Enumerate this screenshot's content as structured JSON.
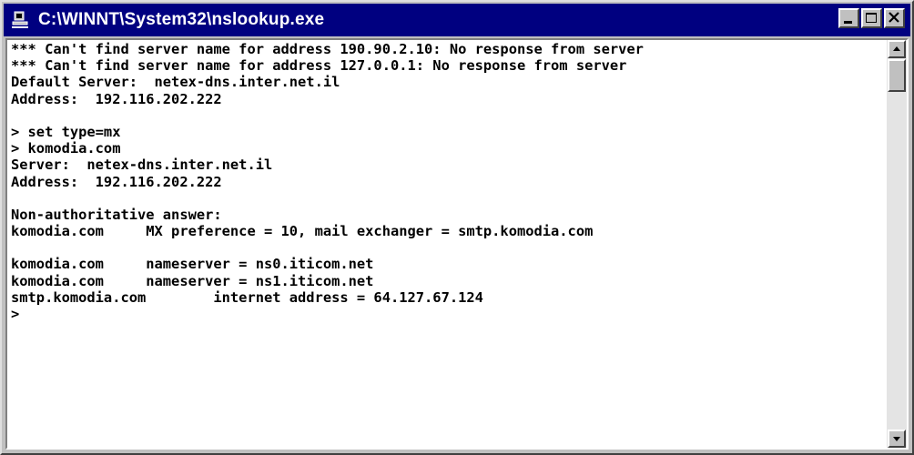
{
  "window": {
    "title": "C:\\WINNT\\System32\\nslookup.exe",
    "icon": "console-app-icon",
    "controls": [
      "minimize-icon",
      "maximize-icon",
      "close-icon"
    ]
  },
  "colors": {
    "titlebar": "#000080",
    "title_text": "#ffffff",
    "console_bg": "#ffffff",
    "console_text": "#000000",
    "chrome": "#c0c0c0"
  },
  "console": {
    "lines": [
      "*** Can't find server name for address 190.90.2.10: No response from server",
      "*** Can't find server name for address 127.0.0.1: No response from server",
      "Default Server:  netex-dns.inter.net.il",
      "Address:  192.116.202.222",
      "",
      "> set type=mx",
      "> komodia.com",
      "Server:  netex-dns.inter.net.il",
      "Address:  192.116.202.222",
      "",
      "Non-authoritative answer:",
      "komodia.com     MX preference = 10, mail exchanger = smtp.komodia.com",
      "",
      "komodia.com     nameserver = ns0.iticom.net",
      "komodia.com     nameserver = ns1.iticom.net",
      "smtp.komodia.com        internet address = 64.127.67.124",
      ">"
    ]
  },
  "scrollbar": {
    "up_icon": "scroll-up-arrow-icon",
    "down_icon": "scroll-down-arrow-icon"
  }
}
